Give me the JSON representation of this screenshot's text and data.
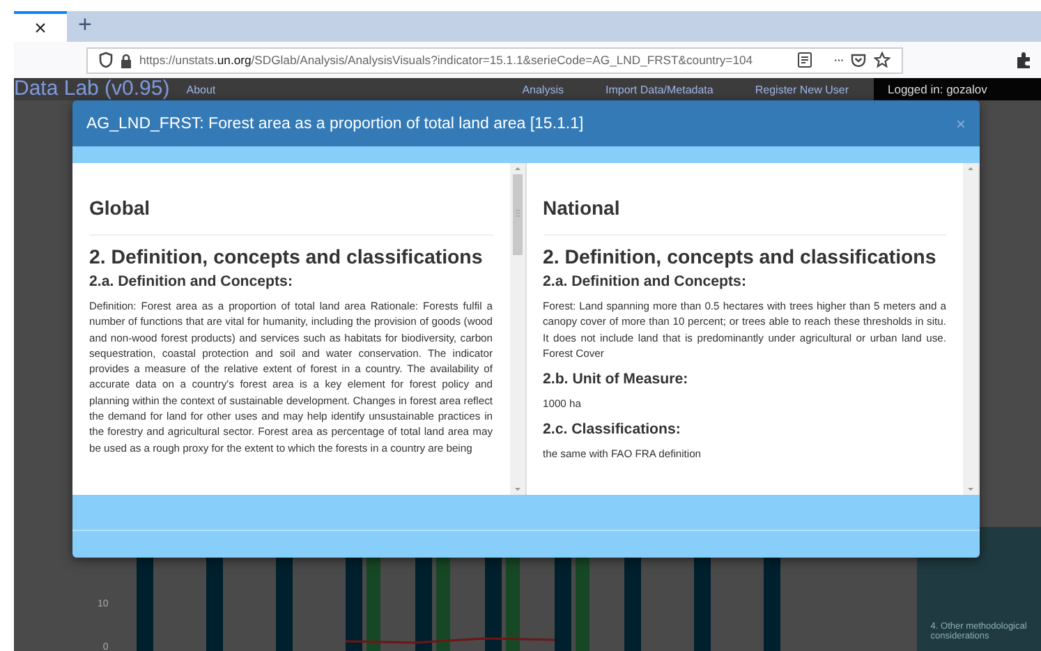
{
  "browser": {
    "tab_close": "×",
    "new_tab": "+",
    "url": "https://unstats.**un.org**/SDGlab/Analysis/AnalysisVisuals?indicator=15.1.1&serieCode=AG_LND_FRST&country=104",
    "more": "···"
  },
  "page": {
    "brand": "Data Lab (v0.95)",
    "nav": [
      {
        "label": "About"
      },
      {
        "label": "Analysis"
      },
      {
        "label": "Import Data/Metadata"
      },
      {
        "label": "Register New User"
      }
    ],
    "login": "Logged in: gozalov",
    "axis_labels": [
      "10",
      "0"
    ],
    "side_note": "4. Other methodological considerations"
  },
  "modal": {
    "title": "AG_LND_FRST: Forest area as a proportion of total land area [15.1.1]",
    "close": "×",
    "panes": [
      {
        "heading": "Global",
        "blocks": [
          {
            "kind": "h2",
            "text": "2. Definition, concepts and classifications"
          },
          {
            "kind": "h3",
            "text": "2.a. Definition and Concepts:"
          },
          {
            "kind": "p",
            "text": "Definition: Forest area as a proportion of total land area Rationale: Forests fulfil a number of functions that are vital for humanity, including the provision of goods (wood and non-wood forest products) and services such as habitats for biodiversity, carbon sequestration, coastal protection and soil and water conservation. The indicator provides a measure of the relative extent of forest in a country. The availability of accurate data on a country's forest area is a key element for forest policy and planning within the context of sustainable development. Changes in forest area reflect the demand for land for other uses and may help identify unsustainable practices in the forestry and agricultural sector. Forest area as percentage of total land area may be used as a rough proxy for the extent to which the forests in a country are being"
          }
        ]
      },
      {
        "heading": "National",
        "blocks": [
          {
            "kind": "h2",
            "text": "2. Definition, concepts and classifications"
          },
          {
            "kind": "h3",
            "text": "2.a. Definition and Concepts:"
          },
          {
            "kind": "p",
            "text": "Forest: Land spanning more than 0.5 hectares with trees higher than 5 meters and a canopy cover of more than 10 percent; or trees able to reach these thresholds in situ. It does not include land that is predominantly under agricultural or urban land use. Forest Cover"
          },
          {
            "kind": "h3",
            "text": "2.b. Unit of Measure:"
          },
          {
            "kind": "p",
            "text": "1000 ha"
          },
          {
            "kind": "h3",
            "text": "2.c. Classifications:"
          },
          {
            "kind": "p",
            "text": "the same with FAO FRA definition"
          }
        ]
      }
    ]
  }
}
